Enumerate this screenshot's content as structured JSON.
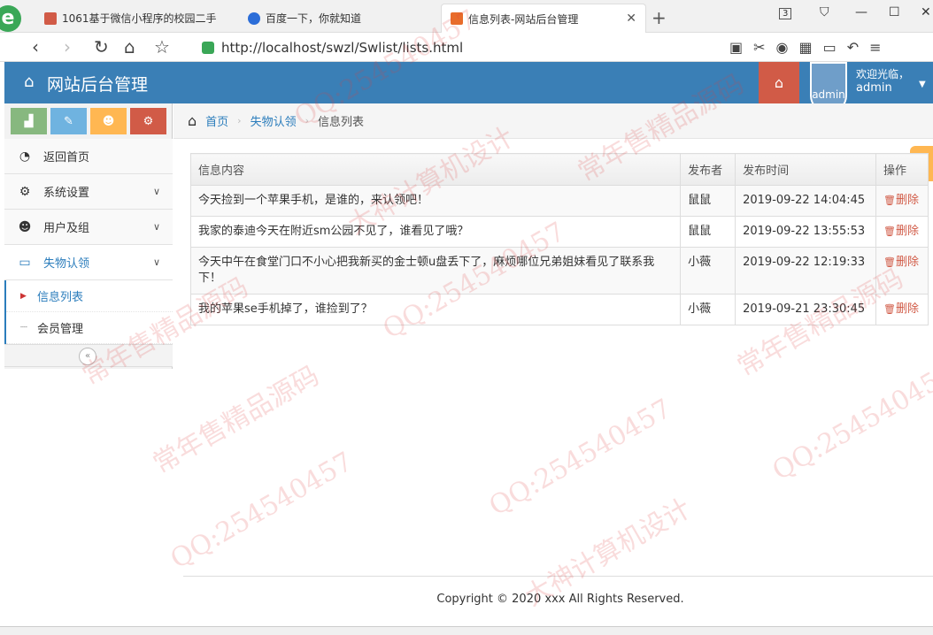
{
  "browser": {
    "logo_letter": "e",
    "tabs": [
      {
        "title": "1061基于微信小程序的校园二手",
        "active": false,
        "icon_color": "#d15b47"
      },
      {
        "title": "百度一下，你就知道",
        "active": false,
        "icon_color": "#2b6dd8"
      },
      {
        "title": "信息列表-网站后台管理",
        "active": true,
        "icon_color": "#e86c2b"
      }
    ],
    "tab_count": "3",
    "url": "http://localhost/swzl/Swlist/lists.html"
  },
  "header": {
    "title": "网站后台管理",
    "welcome": "欢迎光临，",
    "username": "admin",
    "avatar_alt": "admin",
    "colors": {
      "bar": "#3a7fb6",
      "home_button": "#d15b47"
    }
  },
  "sidebar": {
    "shortcuts": [
      {
        "icon": "signal-icon",
        "color": "#87b87f"
      },
      {
        "icon": "pencil-icon",
        "color": "#6fb3e0"
      },
      {
        "icon": "users-icon",
        "color": "#ffb752"
      },
      {
        "icon": "cogs-icon",
        "color": "#d15b47"
      }
    ],
    "items": [
      {
        "label": "返回首页",
        "icon": "dashboard-icon"
      },
      {
        "label": "系统设置",
        "icon": "gear-icon"
      },
      {
        "label": "用户及组",
        "icon": "users-icon"
      },
      {
        "label": "失物认领",
        "icon": "desktop-icon"
      }
    ],
    "submenu": [
      {
        "label": "信息列表",
        "active": true
      },
      {
        "label": "会员管理",
        "active": false
      }
    ],
    "collapse_glyph": "«"
  },
  "breadcrumb": {
    "home": "首页",
    "section": "失物认领",
    "current": "信息列表"
  },
  "table": {
    "headers": [
      "信息内容",
      "发布者",
      "发布时间",
      "操作"
    ],
    "delete_label": "删除",
    "rows": [
      {
        "content": "今天捡到一个苹果手机，是谁的，来认领吧！",
        "publisher": "鼠鼠",
        "time": "2019-09-22 14:04:45"
      },
      {
        "content": "我家的泰迪今天在附近sm公园不见了，谁看见了哦？",
        "publisher": "鼠鼠",
        "time": "2019-09-22 13:55:53"
      },
      {
        "content": "今天中午在食堂门口不小心把我新买的金士顿u盘丢下了，麻烦哪位兄弟姐妹看见了联系我下！",
        "publisher": "小薇",
        "time": "2019-09-22 12:19:33"
      },
      {
        "content": "我的苹果se手机掉了，谁捡到了？",
        "publisher": "小薇",
        "time": "2019-09-21 23:30:45"
      }
    ]
  },
  "footer": {
    "copyright": "Copyright © 2020 xxx All Rights Reserved."
  },
  "watermarks": [
    "QQ:254540457",
    "常年售精品源码",
    "大神计算机设计"
  ]
}
